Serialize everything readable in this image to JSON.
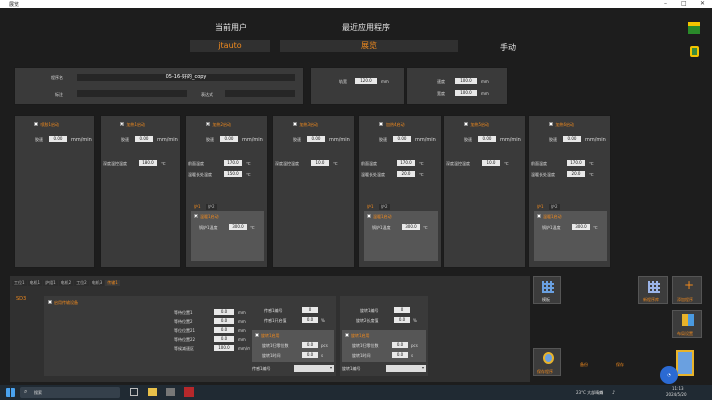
{
  "window": {
    "title": "展览"
  },
  "header": {
    "current_user_label": "当前用户",
    "current_user": "jtauto",
    "recent_program_label": "最近应用程序",
    "recent_program": "展览",
    "mode": "手动"
  },
  "program": {
    "name_label": "程序名",
    "name": "05-16-好的_copy",
    "note_label": "标注",
    "expr_label": "表达式",
    "length_label": "轨宽",
    "length": "120.0",
    "length_unit": "mm",
    "speed_label": "速度",
    "speed": "100.0",
    "speed_unit": "mm",
    "width_label": "宽度",
    "width": "100.0",
    "width_unit": "mm"
  },
  "zones": [
    {
      "title": "喷胶1启动",
      "checked": false,
      "speed_label": "胶速",
      "speed": "0.00",
      "speed_unit": "mm/min"
    },
    {
      "title": "加热1启动",
      "checked": true,
      "speed_label": "胶速",
      "speed": "0.00",
      "speed_unit": "mm/min",
      "temp_label": "深度温控温度",
      "temp": "180.0",
      "temp_unit": "℃"
    },
    {
      "title": "加热2启动",
      "checked": true,
      "speed_label": "胶速",
      "speed": "0.00",
      "speed_unit": "mm/min",
      "temp_label": "前面温度",
      "temp": "170.0",
      "temp_unit": "℃",
      "temp2_label": "温暖长处温度",
      "temp2": "150.0",
      "temp2_unit": "℃",
      "tabs": [
        "炉1",
        "炉2"
      ],
      "heater_title": "温暖1启动",
      "heater_checked": true,
      "heater_label": "锅炉1温度",
      "heater_value": "300.0",
      "heater_unit": "℃"
    },
    {
      "title": "加热3启动",
      "checked": false,
      "speed_label": "胶速",
      "speed": "0.00",
      "speed_unit": "mm/min",
      "temp_label": "深度温控温度",
      "temp": "10.0",
      "temp_unit": "℃"
    },
    {
      "title": "加热4启动",
      "checked": false,
      "speed_label": "胶速",
      "speed": "0.00",
      "speed_unit": "mm/min",
      "temp_label": "前面温度",
      "temp": "170.0",
      "temp_unit": "℃",
      "temp2_label": "温暖长处温度",
      "temp2": "20.0",
      "temp2_unit": "℃",
      "tabs": [
        "炉1",
        "炉2"
      ],
      "heater_title": "温暖1启动",
      "heater_checked": false,
      "heater_label": "锅炉1温度",
      "heater_value": "300.0",
      "heater_unit": "℃"
    },
    {
      "title": "加热5启动",
      "checked": false,
      "speed_label": "胶速",
      "speed": "0.00",
      "speed_unit": "mm/min",
      "temp_label": "深度温控温度",
      "temp": "10.0",
      "temp_unit": "℃"
    },
    {
      "title": "加热6启动",
      "checked": false,
      "speed_label": "胶速",
      "speed": "0.00",
      "speed_unit": "mm/min",
      "temp_label": "前面温度",
      "temp": "170.0",
      "temp_unit": "℃",
      "temp2_label": "温暖长处温度",
      "temp2": "20.0",
      "temp2_unit": "℃",
      "tabs": [
        "炉1",
        "炉2"
      ],
      "heater_title": "温暖1启动",
      "heater_checked": false,
      "heater_label": "锅炉1温度",
      "heater_value": "300.0",
      "heater_unit": "℃"
    }
  ],
  "bottom": {
    "tabs": [
      "工位1",
      "电机1",
      "炉组1",
      "电机2",
      "工位2",
      "电机3",
      "传输1"
    ],
    "active_tab": 6,
    "section": "SD3",
    "enable_label": "启用传输设备",
    "fields": [
      {
        "label": "等待位置1",
        "value": "0.0",
        "unit": "mm"
      },
      {
        "label": "等待位置2",
        "value": "0.0",
        "unit": "mm"
      },
      {
        "label": "等位位置21",
        "value": "0.0",
        "unit": "mm"
      },
      {
        "label": "等待位置22",
        "value": "0.0",
        "unit": "mm"
      },
      {
        "label": "等候减速区",
        "value": "100.0",
        "unit": "mm/m"
      }
    ],
    "mid": {
      "top_label": "传感1编号",
      "top_value": "0",
      "second_label": "传感1开启值",
      "second_value": "0.0",
      "second_unit": "%",
      "enable_label": "旋转1启用",
      "rows": [
        {
          "label": "旋转1归零位数",
          "value": "0.0",
          "unit": "pcs"
        },
        {
          "label": "旋转1时间",
          "value": "0.0",
          "unit": "s"
        }
      ],
      "select_label": "传感1编号"
    },
    "right": {
      "top_label": "旋转1编号",
      "top_value": "0",
      "second_label": "旋转2长度值",
      "second_value": "0.0",
      "second_unit": "%",
      "enable_label": "旋转1启用",
      "rows": [
        {
          "label": "旋转1归零位数",
          "value": "0.0",
          "unit": "pcs"
        },
        {
          "label": "旋转1时间",
          "value": "0.0",
          "unit": "s"
        }
      ],
      "select_label": "旋转1编号"
    }
  },
  "buttons": {
    "grid": "模板",
    "new_program": "新程序库",
    "add_program": "添加程序",
    "layout": "布局设置",
    "save": "保存程序",
    "backup": "备份",
    "save2": "保存"
  },
  "taskbar": {
    "search": "搜索",
    "weather": "23°C 大部晴朗",
    "time": "11:13",
    "date": "2024/5/20"
  },
  "colors": {
    "accent": "#f08a1e",
    "background": "#1d1d1d",
    "panel": "#3a3a3a"
  }
}
